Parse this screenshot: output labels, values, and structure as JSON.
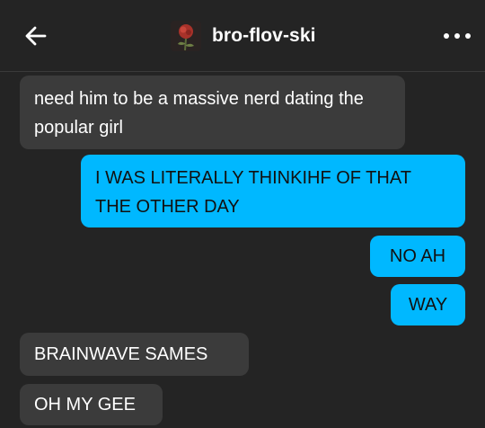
{
  "header": {
    "back_icon": "arrow-left-icon",
    "title": "bro-flov-ski",
    "avatar_icon": "rose-avatar",
    "more_icon": "ellipsis-icon"
  },
  "messages": [
    {
      "direction": "incoming",
      "text": "need him to be a massive nerd dating the popular girl"
    },
    {
      "direction": "outgoing",
      "text": "I WAS LITERALLY THINKIHF OF THAT THE OTHER DAY"
    },
    {
      "direction": "outgoing",
      "text": "NO AH"
    },
    {
      "direction": "outgoing",
      "text": "WAY"
    },
    {
      "direction": "incoming",
      "text": "BRAINWAVE SAMES"
    },
    {
      "direction": "incoming",
      "text": "OH MY GEE"
    }
  ],
  "colors": {
    "background": "#242424",
    "incoming_bubble": "#3b3b3b",
    "outgoing_bubble": "#00b8ff"
  }
}
